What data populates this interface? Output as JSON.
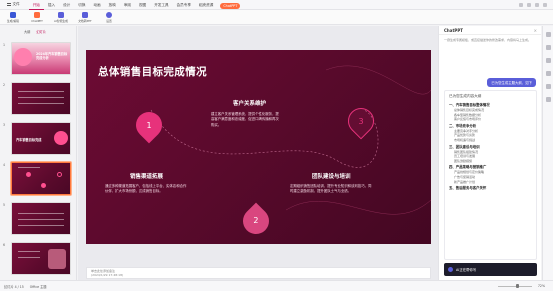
{
  "menu": {
    "file_label": "文件",
    "tabs": [
      "开始",
      "插入",
      "设计",
      "切换",
      "动画",
      "放映",
      "审阅",
      "视图",
      "开发工具",
      "会员专享",
      "稻壳资源"
    ],
    "active_index": 0,
    "chatppt_label": "ChatPPT"
  },
  "ribbon": {
    "buttons": [
      {
        "label": "生成/编辑",
        "color": "#3a57d6"
      },
      {
        "label": "ChatPPT",
        "color": "#ff6b3d"
      },
      {
        "label": "AI智能生成",
        "color": "#5a5ed9"
      },
      {
        "label": "文档转PPT",
        "color": "#5a5ed9"
      },
      {
        "label": "设置",
        "color": "#5a5ed9"
      }
    ]
  },
  "thumbs": {
    "tab_outline": "大纲",
    "tab_slides": "幻灯片",
    "slides": [
      {
        "num": "1",
        "title": "2024年汽车销售目标完成分析"
      },
      {
        "num": "2",
        "title": ""
      },
      {
        "num": "3",
        "title": "汽车销售目标完成"
      },
      {
        "num": "4",
        "title": ""
      },
      {
        "num": "5",
        "title": ""
      },
      {
        "num": "6",
        "title": ""
      },
      {
        "num": "7",
        "title": ""
      }
    ]
  },
  "slide": {
    "title": "总体销售目标完成情况",
    "sections": [
      {
        "num": "1",
        "heading": "客户关系维护",
        "text": "建立客户关系管理系统，提供个性化服务，提高客户满意度和忠诚度，促进口碑传播和再次购买。"
      },
      {
        "num": "2",
        "heading": "销售渠道拓展",
        "text": "通过多种渠道拓展客户，包括线上平台、实体店和合作伙伴，扩大市场份额，达成销售目标。"
      },
      {
        "num": "3",
        "heading": "团队建设与培训",
        "text": "定期组织销售团队培训，提升专业知识和谈判技巧，同时建立激励机制，提升团队士气与业绩。"
      }
    ]
  },
  "notes": {
    "line1": "单击此处添加备注",
    "line2": "(2024/1/29 17:48:18)"
  },
  "chat": {
    "title": "ChatPPT",
    "close": "×",
    "intro": "一键生成专属模板，或直接描述你的修改需求，内容将马上生成。",
    "request_bubble": "已为您生成主题大纲，如下",
    "outline_title": "已为您生成内容大纲",
    "outline": [
      {
        "heading": "一、汽车销售目标整体情况",
        "items": [
          "总体销售目标完成情况",
          "各车型销售数据分析",
          "客户反馈与市场评价"
        ]
      },
      {
        "heading": "二、市场竞争分析",
        "items": [
          "主要竞争对手分析",
          "产品优势与劣势",
          "市场机遇与挑战"
        ]
      },
      {
        "heading": "三、团队建设与培训",
        "items": [
          "销售团队组建情况",
          "员工培训与发展",
          "团队激励措施"
        ]
      },
      {
        "heading": "四、产品策略与营销推广",
        "items": [
          "产品线规划与定价策略",
          "广告与促销活动",
          "新产品推广计划"
        ]
      },
      {
        "heading": "五、售后服务与客户关怀",
        "items": []
      }
    ],
    "input_label": "AI正在帮你写"
  },
  "statusbar": {
    "slide_info": "幻灯片 4 / 15",
    "theme": "Office 主题",
    "zoom": "72%"
  }
}
